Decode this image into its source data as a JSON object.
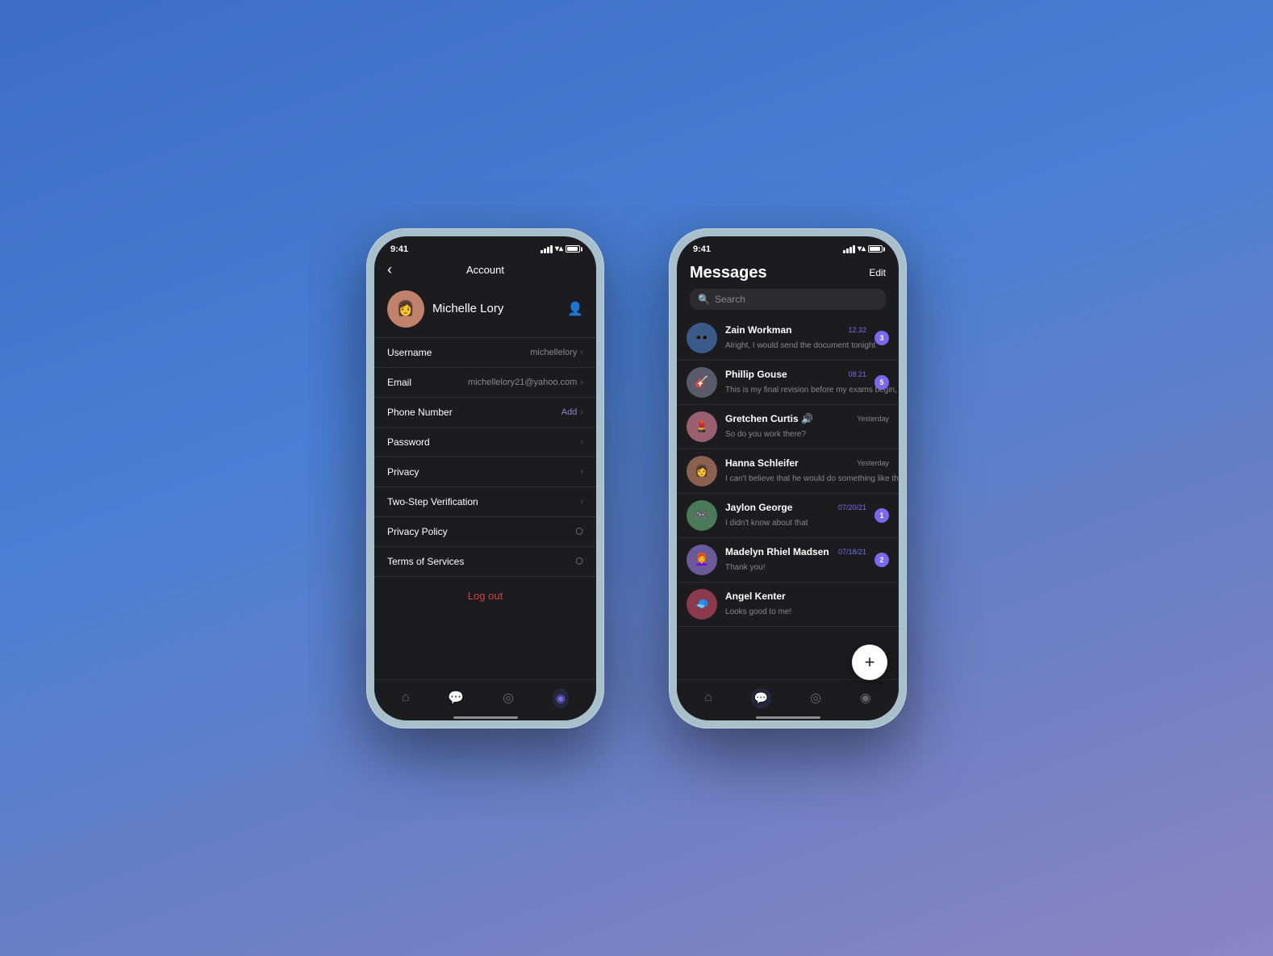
{
  "phone1": {
    "statusBar": {
      "time": "9:41"
    },
    "header": {
      "back": "‹",
      "title": "Account"
    },
    "profile": {
      "name": "Michelle Lory",
      "avatar": "👩"
    },
    "settings": [
      {
        "label": "Username",
        "value": "michellelory",
        "type": "chevron"
      },
      {
        "label": "Email",
        "value": "michellelory21@yahoo.com",
        "type": "chevron"
      },
      {
        "label": "Phone Number",
        "value": "Add",
        "type": "add"
      },
      {
        "label": "Password",
        "value": "",
        "type": "chevron"
      },
      {
        "label": "Privacy",
        "value": "",
        "type": "chevron"
      },
      {
        "label": "Two-Step Verification",
        "value": "",
        "type": "chevron"
      }
    ],
    "links": [
      {
        "label": "Privacy Policy",
        "type": "external"
      },
      {
        "label": "Terms of Services",
        "type": "external"
      }
    ],
    "logout": "Log out",
    "bottomNav": [
      {
        "icon": "⌂",
        "label": "home"
      },
      {
        "icon": "💬",
        "label": "chat"
      },
      {
        "icon": "◎",
        "label": "discover"
      },
      {
        "icon": "◉",
        "label": "profile",
        "active": true
      }
    ]
  },
  "phone2": {
    "statusBar": {
      "time": "9:41"
    },
    "header": {
      "title": "Messages",
      "edit": "Edit"
    },
    "search": {
      "placeholder": "Search"
    },
    "messages": [
      {
        "name": "Zain Workman",
        "preview": "Alright, I would send the document tonight",
        "time": "12.32",
        "badge": 3,
        "timeColor": "purple",
        "avatarColor": "av-blue"
      },
      {
        "name": "Phillip Gouse",
        "preview": "This is my final revision before my exams begin, what do you think?",
        "time": "08.21",
        "badge": 5,
        "timeColor": "purple",
        "avatarColor": "av-gray"
      },
      {
        "name": "Gretchen Curtis 🔊",
        "preview": "So do you work there?",
        "time": "Yesterday",
        "badge": 0,
        "timeColor": "gray",
        "avatarColor": "av-pink"
      },
      {
        "name": "Hanna Schleifer",
        "preview": "I can't believe that he would do something like that smh",
        "time": "Yesterday",
        "badge": 0,
        "timeColor": "gray",
        "avatarColor": "av-warm"
      },
      {
        "name": "Jaylon George",
        "preview": "I didn't know about that",
        "time": "07/20/21",
        "badge": 1,
        "timeColor": "purple",
        "avatarColor": "av-green"
      },
      {
        "name": "Madelyn Rhiel Madsen",
        "preview": "Thank you!",
        "time": "07/18/21",
        "badge": 2,
        "timeColor": "purple",
        "avatarColor": "av-purple"
      },
      {
        "name": "Angel Kenter",
        "preview": "Looks good to me!",
        "time": "",
        "badge": 0,
        "timeColor": "gray",
        "avatarColor": "av-red"
      }
    ],
    "fab": "+",
    "bottomNav": [
      {
        "icon": "⌂",
        "label": "home"
      },
      {
        "icon": "💬",
        "label": "chat",
        "active": true
      },
      {
        "icon": "◎",
        "label": "discover"
      },
      {
        "icon": "◉",
        "label": "profile"
      }
    ]
  }
}
